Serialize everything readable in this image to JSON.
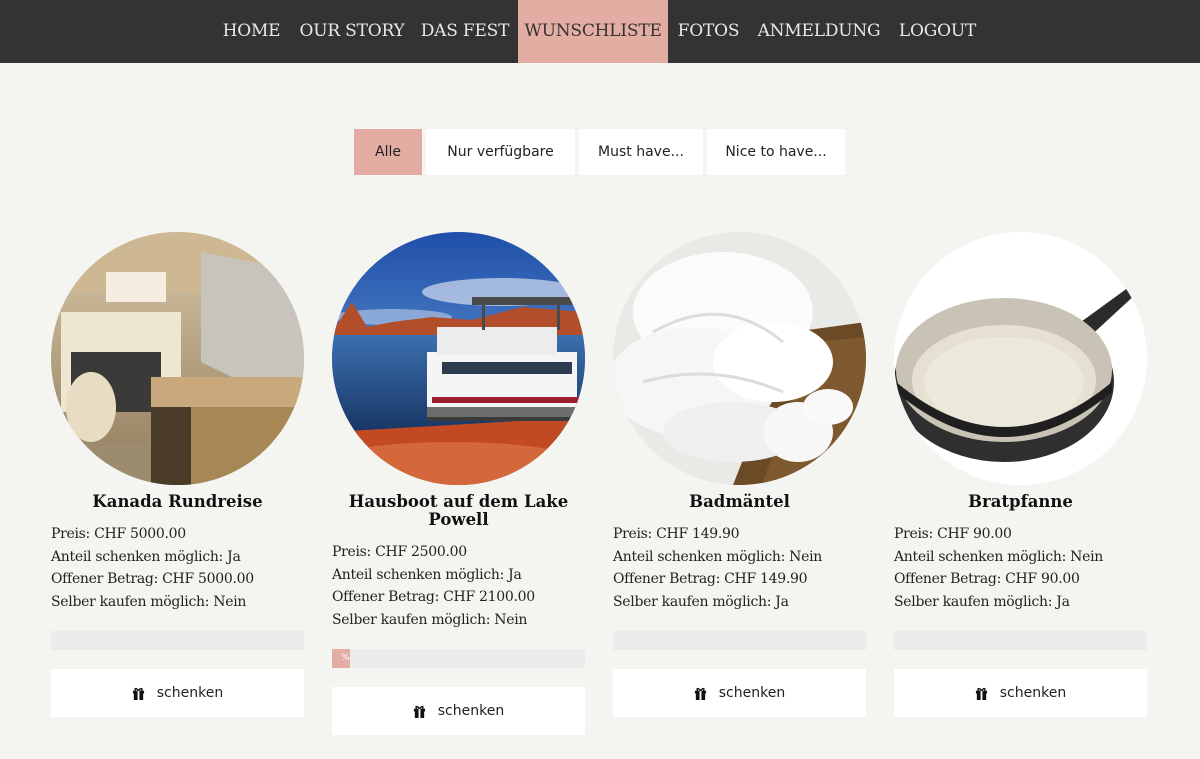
{
  "nav": {
    "items": [
      {
        "label": "HOME"
      },
      {
        "label": "OUR STORY"
      },
      {
        "label": "DAS FEST"
      },
      {
        "label": "WUNSCHLISTE",
        "active": true
      },
      {
        "label": "FOTOS"
      },
      {
        "label": "ANMELDUNG"
      },
      {
        "label": "LOGOUT"
      }
    ]
  },
  "filters": [
    {
      "label": "Alle",
      "active": true
    },
    {
      "label": "Nur verfügbare"
    },
    {
      "label": "Must have..."
    },
    {
      "label": "Nice to have..."
    }
  ],
  "colors": {
    "accent": "#e3ada3",
    "navbar": "#333333",
    "background": "#f4f4f0"
  },
  "gift_button_label": "schenken",
  "gift_icon": "gift-icon",
  "products": [
    {
      "title": "Kanada Rundreise",
      "image": "camper-interior",
      "price": "Preis: CHF 5000.00",
      "share": "Anteil schenken möglich: Ja",
      "open": "Offener Betrag: CHF 5000.00",
      "self_buy": "Selber kaufen möglich: Nein",
      "progress": 0
    },
    {
      "title": "Hausboot auf dem Lake Powell",
      "image": "houseboat-lake",
      "price": "Preis: CHF 2500.00",
      "share": "Anteil schenken möglich: Ja",
      "open": "Offener Betrag: CHF 2100.00",
      "self_buy": "Selber kaufen möglich: Nein",
      "progress": 0.07,
      "progress_label": "%"
    },
    {
      "title": "Badmäntel",
      "image": "bathrobes",
      "price": "Preis: CHF 149.90",
      "share": "Anteil schenken möglich: Nein",
      "open": "Offener Betrag: CHF 149.90",
      "self_buy": "Selber kaufen möglich: Ja",
      "progress": 0
    },
    {
      "title": "Bratpfanne",
      "image": "frying-pan",
      "price": "Preis: CHF 90.00",
      "share": "Anteil schenken möglich: Nein",
      "open": "Offener Betrag: CHF 90.00",
      "self_buy": "Selber kaufen möglich: Ja",
      "progress": 0
    }
  ]
}
